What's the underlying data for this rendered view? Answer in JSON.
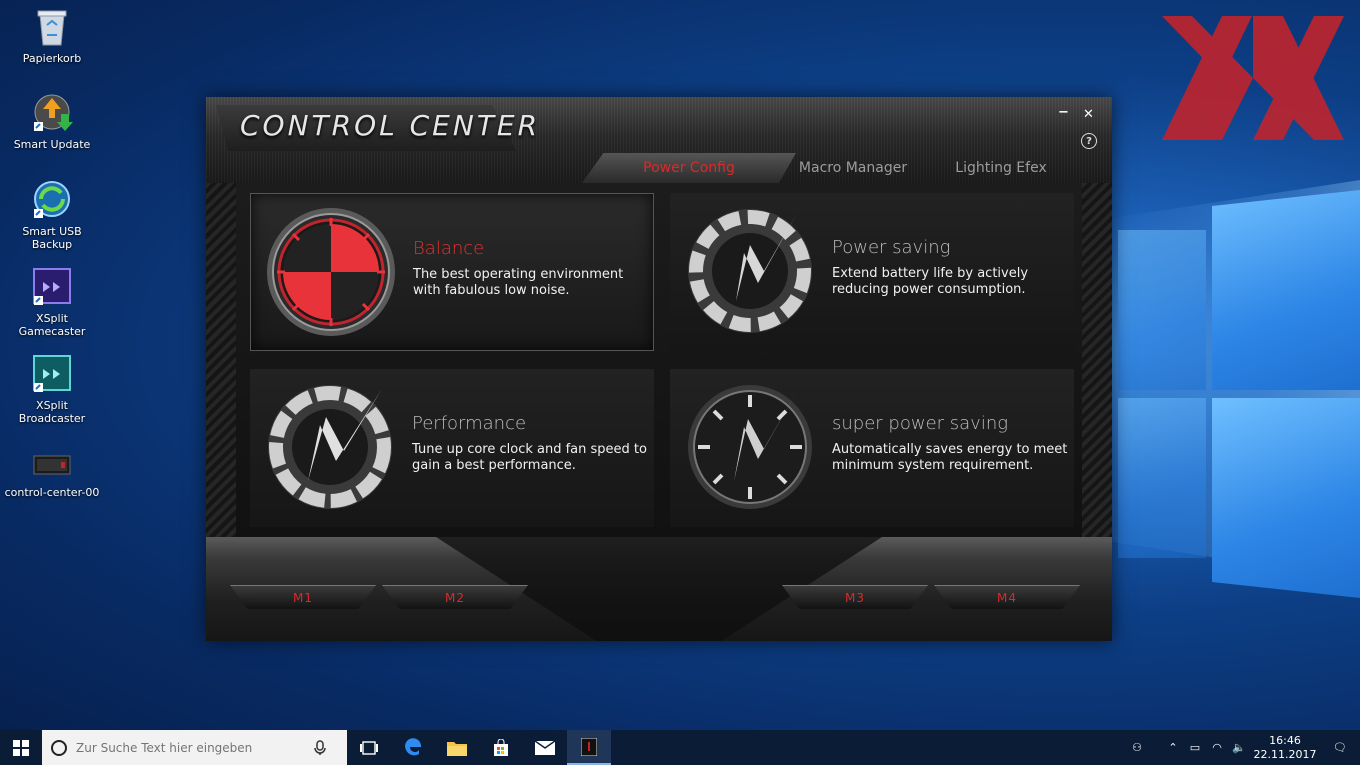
{
  "desktop": {
    "icons": [
      {
        "label": "Papierkorb",
        "icon": "recycle-bin-icon"
      },
      {
        "label": "Smart Update",
        "icon": "smart-update-icon"
      },
      {
        "label": "Smart USB Backup",
        "icon": "usb-backup-icon"
      },
      {
        "label": "XSplit Gamecaster",
        "icon": "xsplit-gamecaster-icon"
      },
      {
        "label": "XSplit Broadcaster",
        "icon": "xsplit-broadcaster-icon"
      },
      {
        "label": "control-center-00",
        "icon": "control-center-file-icon"
      }
    ]
  },
  "app": {
    "title": "CONTROL CENTER",
    "minimize": "−",
    "close": "✕",
    "help": "?",
    "tabs": [
      {
        "label": "Power Config",
        "active": true
      },
      {
        "label": "Macro Manager",
        "active": false
      },
      {
        "label": "Lighting Efex",
        "active": false
      }
    ],
    "modes": [
      {
        "title": "Balance",
        "desc": "The best operating environment with fabulous low noise.",
        "active": true
      },
      {
        "title": "Power saving",
        "desc": "Extend battery life by actively reducing power consumption.",
        "active": false
      },
      {
        "title": "Performance",
        "desc": "Tune up core clock and fan speed to gain a best performance.",
        "active": false
      },
      {
        "title": "super power saving",
        "desc": "Automatically saves energy to meet minimum system requirement.",
        "active": false
      }
    ],
    "macro_buttons": [
      "M1",
      "M2",
      "M3",
      "M4"
    ],
    "colors": {
      "accent": "#d82a2a",
      "bg": "#141414"
    }
  },
  "taskbar": {
    "search_placeholder": "Zur Suche Text hier eingeben",
    "time": "16:46",
    "date": "22.11.2017"
  }
}
